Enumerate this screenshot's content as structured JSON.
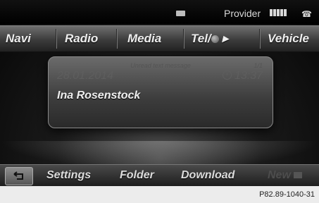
{
  "status": {
    "provider_label": "Provider",
    "message_icon": "envelope-icon",
    "signal_icon": "signal-strength-icon",
    "phone_icon": "phone-hangup-icon"
  },
  "main_menu": {
    "navi": "Navi",
    "radio": "Radio",
    "media": "Media",
    "tel": "Tel/",
    "vehicle": "Vehicle"
  },
  "message": {
    "title": "Unread text message",
    "count": "1/1",
    "date": "28.01.2014",
    "time": "13:37",
    "sender": "Ina Rosenstock"
  },
  "bottom_menu": {
    "back_icon": "back-arrow-icon",
    "settings": "Settings",
    "folder": "Folder",
    "download": "Download",
    "new": "New"
  },
  "caption": "P82.89-1040-31"
}
